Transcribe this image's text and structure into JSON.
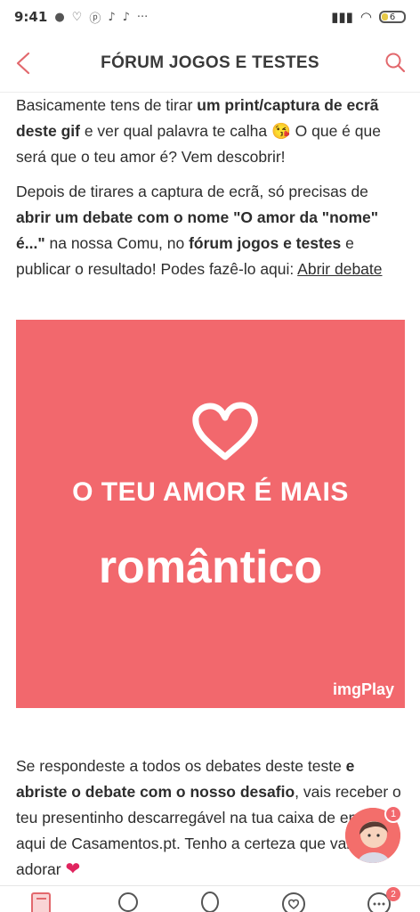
{
  "status_bar": {
    "time": "9:41",
    "notif_icons": [
      "facebook-icon",
      "heart-app-icon",
      "pinterest-icon",
      "tiktok-icon",
      "tiktok-icon",
      "more-icon"
    ],
    "battery": "6"
  },
  "header": {
    "title": "FÓRUM JOGOS E TESTES",
    "accent_color": "#e2686d"
  },
  "paragraph1": {
    "t1": "Basicamente tens de tirar ",
    "b1": "um print/captura de ecrã deste gif",
    "t2": " e ver qual palavra te calha ",
    "emoji": "😘",
    "t3": " O que é que será que o teu amor é? Vem descobrir!"
  },
  "paragraph2": {
    "t1": "Depois de tirares a captura de ecrã, só precisas de ",
    "b1": "abrir um debate com o nome \"O amor da \"nome\" é...\"",
    "t2": " na nossa Comu, no ",
    "b2": "fórum jogos e testes",
    "t3": " e publicar o resultado! Podes fazê-lo aqui: ",
    "link": "Abrir debate"
  },
  "banner": {
    "line1": "O TEU AMOR É MAIS",
    "line2": "romântico",
    "brand": "imgPlay",
    "bg_color": "#f2686d"
  },
  "paragraph3": {
    "t1": "Se respondeste a todos os debates deste teste ",
    "b1": "e abriste o debate com o nosso desafio",
    "t2": ", vais receber o teu presentinho descarregável na tua caixa de entrada aqui de Casamentos.pt. Tenho a certeza que vais adorar ",
    "heart": "❤"
  },
  "assistant": {
    "badge": "1"
  },
  "tabbar": {
    "icons": [
      "notebook-icon",
      "balloon-icon",
      "balloon-icon",
      "heart-circle-icon",
      "chat-icon"
    ],
    "chat_badge": "2"
  }
}
